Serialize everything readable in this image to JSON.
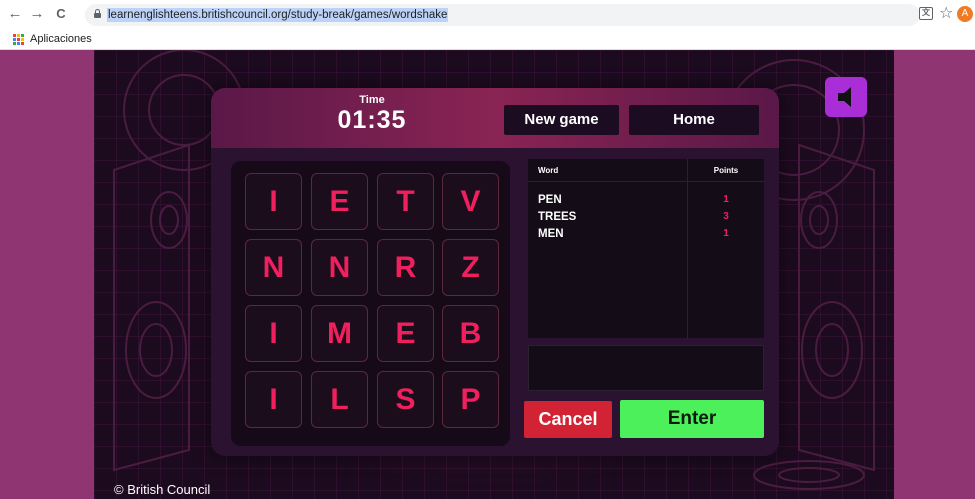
{
  "browser": {
    "url": "learnenglishteens.britishcouncil.org/study-break/games/wordshake",
    "back_icon": "←",
    "forward_icon": "→",
    "reload_icon": "C",
    "translate_icon_glyph": "文",
    "star_icon": "☆",
    "avatar_letter": "A",
    "bookmarks": {
      "apps_label": "Aplicaciones"
    },
    "apps_icon_colors": [
      "#ea4335",
      "#fbbc05",
      "#34a853",
      "#4285f4",
      "#ea4335",
      "#fbbc05",
      "#34a853",
      "#4285f4",
      "#ea4335"
    ]
  },
  "game": {
    "timer": {
      "label": "Time",
      "value": "01:35"
    },
    "buttons": {
      "new_game": "New game",
      "home": "Home",
      "cancel": "Cancel",
      "enter": "Enter"
    },
    "board": [
      [
        "I",
        "E",
        "T",
        "V"
      ],
      [
        "N",
        "N",
        "R",
        "Z"
      ],
      [
        "I",
        "M",
        "E",
        "B"
      ],
      [
        "I",
        "L",
        "S",
        "P"
      ]
    ],
    "word_table": {
      "headers": {
        "word": "Word",
        "points": "Points"
      },
      "rows": [
        {
          "word": "PEN",
          "points": "1"
        },
        {
          "word": "TREES",
          "points": "3"
        },
        {
          "word": "MEN",
          "points": "1"
        }
      ]
    },
    "current_word": ""
  },
  "footer": {
    "copyright": "© British Council"
  },
  "colors": {
    "page_bg": "#8e3572",
    "game_bg": "#1c0b1e",
    "tile_letter": "#f0205e",
    "cancel": "#d12334",
    "enter": "#4cf05a",
    "sound_button": "#a92ed8"
  }
}
